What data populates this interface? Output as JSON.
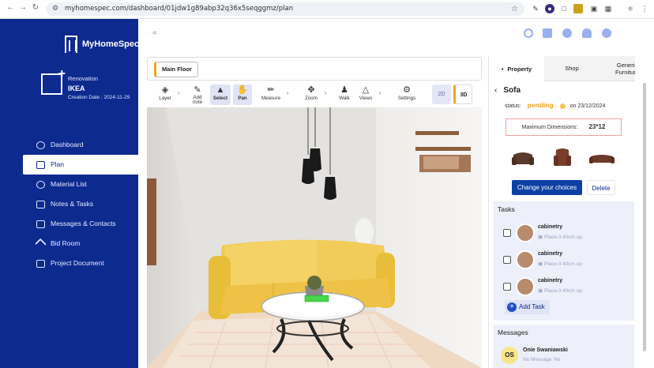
{
  "browser": {
    "url": "myhomespec.com/dashboard/01jdw1g89abp32q36x5seqggmz/plan"
  },
  "brand": {
    "name": "MyHomeSpec"
  },
  "renovation": {
    "label": "Renovation",
    "name": "IKEA",
    "created": "Creation Date : 2024-11-29"
  },
  "menu": [
    {
      "label": "Dashboard"
    },
    {
      "label": "Plan"
    },
    {
      "label": "Material List"
    },
    {
      "label": "Notes & Tasks"
    },
    {
      "label": "Messages & Contacts"
    },
    {
      "label": "Bid Room"
    },
    {
      "label": "Project Document"
    }
  ],
  "floor": {
    "label": "Main Floor"
  },
  "toolbar": {
    "layer": "Layer",
    "add_note": "Add note",
    "select": "Select",
    "pan": "Pan",
    "measure": "Measure",
    "zoom": "Zoom",
    "walk": "Walk",
    "views": "Views",
    "settings": "Settings",
    "mode2d": "2D",
    "mode3d": "3D"
  },
  "tabs": [
    {
      "label": "Property"
    },
    {
      "label": "Shop"
    },
    {
      "label": "Generic Furniture"
    }
  ],
  "item": {
    "title": "Sofa",
    "status_label": "status:",
    "status": "pending",
    "date": "on 23/12/2024",
    "dims_label": "Maximum Dimensions:",
    "dims": "23*12",
    "change_btn": "Change your choices",
    "delete_btn": "Delete"
  },
  "tasks": {
    "title": "Tasks",
    "items": [
      {
        "name": "cabinetry",
        "sub": "Place it 40cm up"
      },
      {
        "name": "cabinetry",
        "sub": "Place it 40cm up"
      },
      {
        "name": "cabinetry",
        "sub": "Place it 40cm up"
      }
    ],
    "add": "Add Task"
  },
  "messages": {
    "title": "Messages",
    "items": [
      {
        "initials": "OS",
        "name": "Onie Swaniawski",
        "sub": "No Message Yet"
      }
    ]
  },
  "colors": {
    "sidebar": "#0d2a8f",
    "accent": "#f4a21b",
    "primary_btn": "#0d3fa5",
    "sofa": "#f1c94a"
  }
}
